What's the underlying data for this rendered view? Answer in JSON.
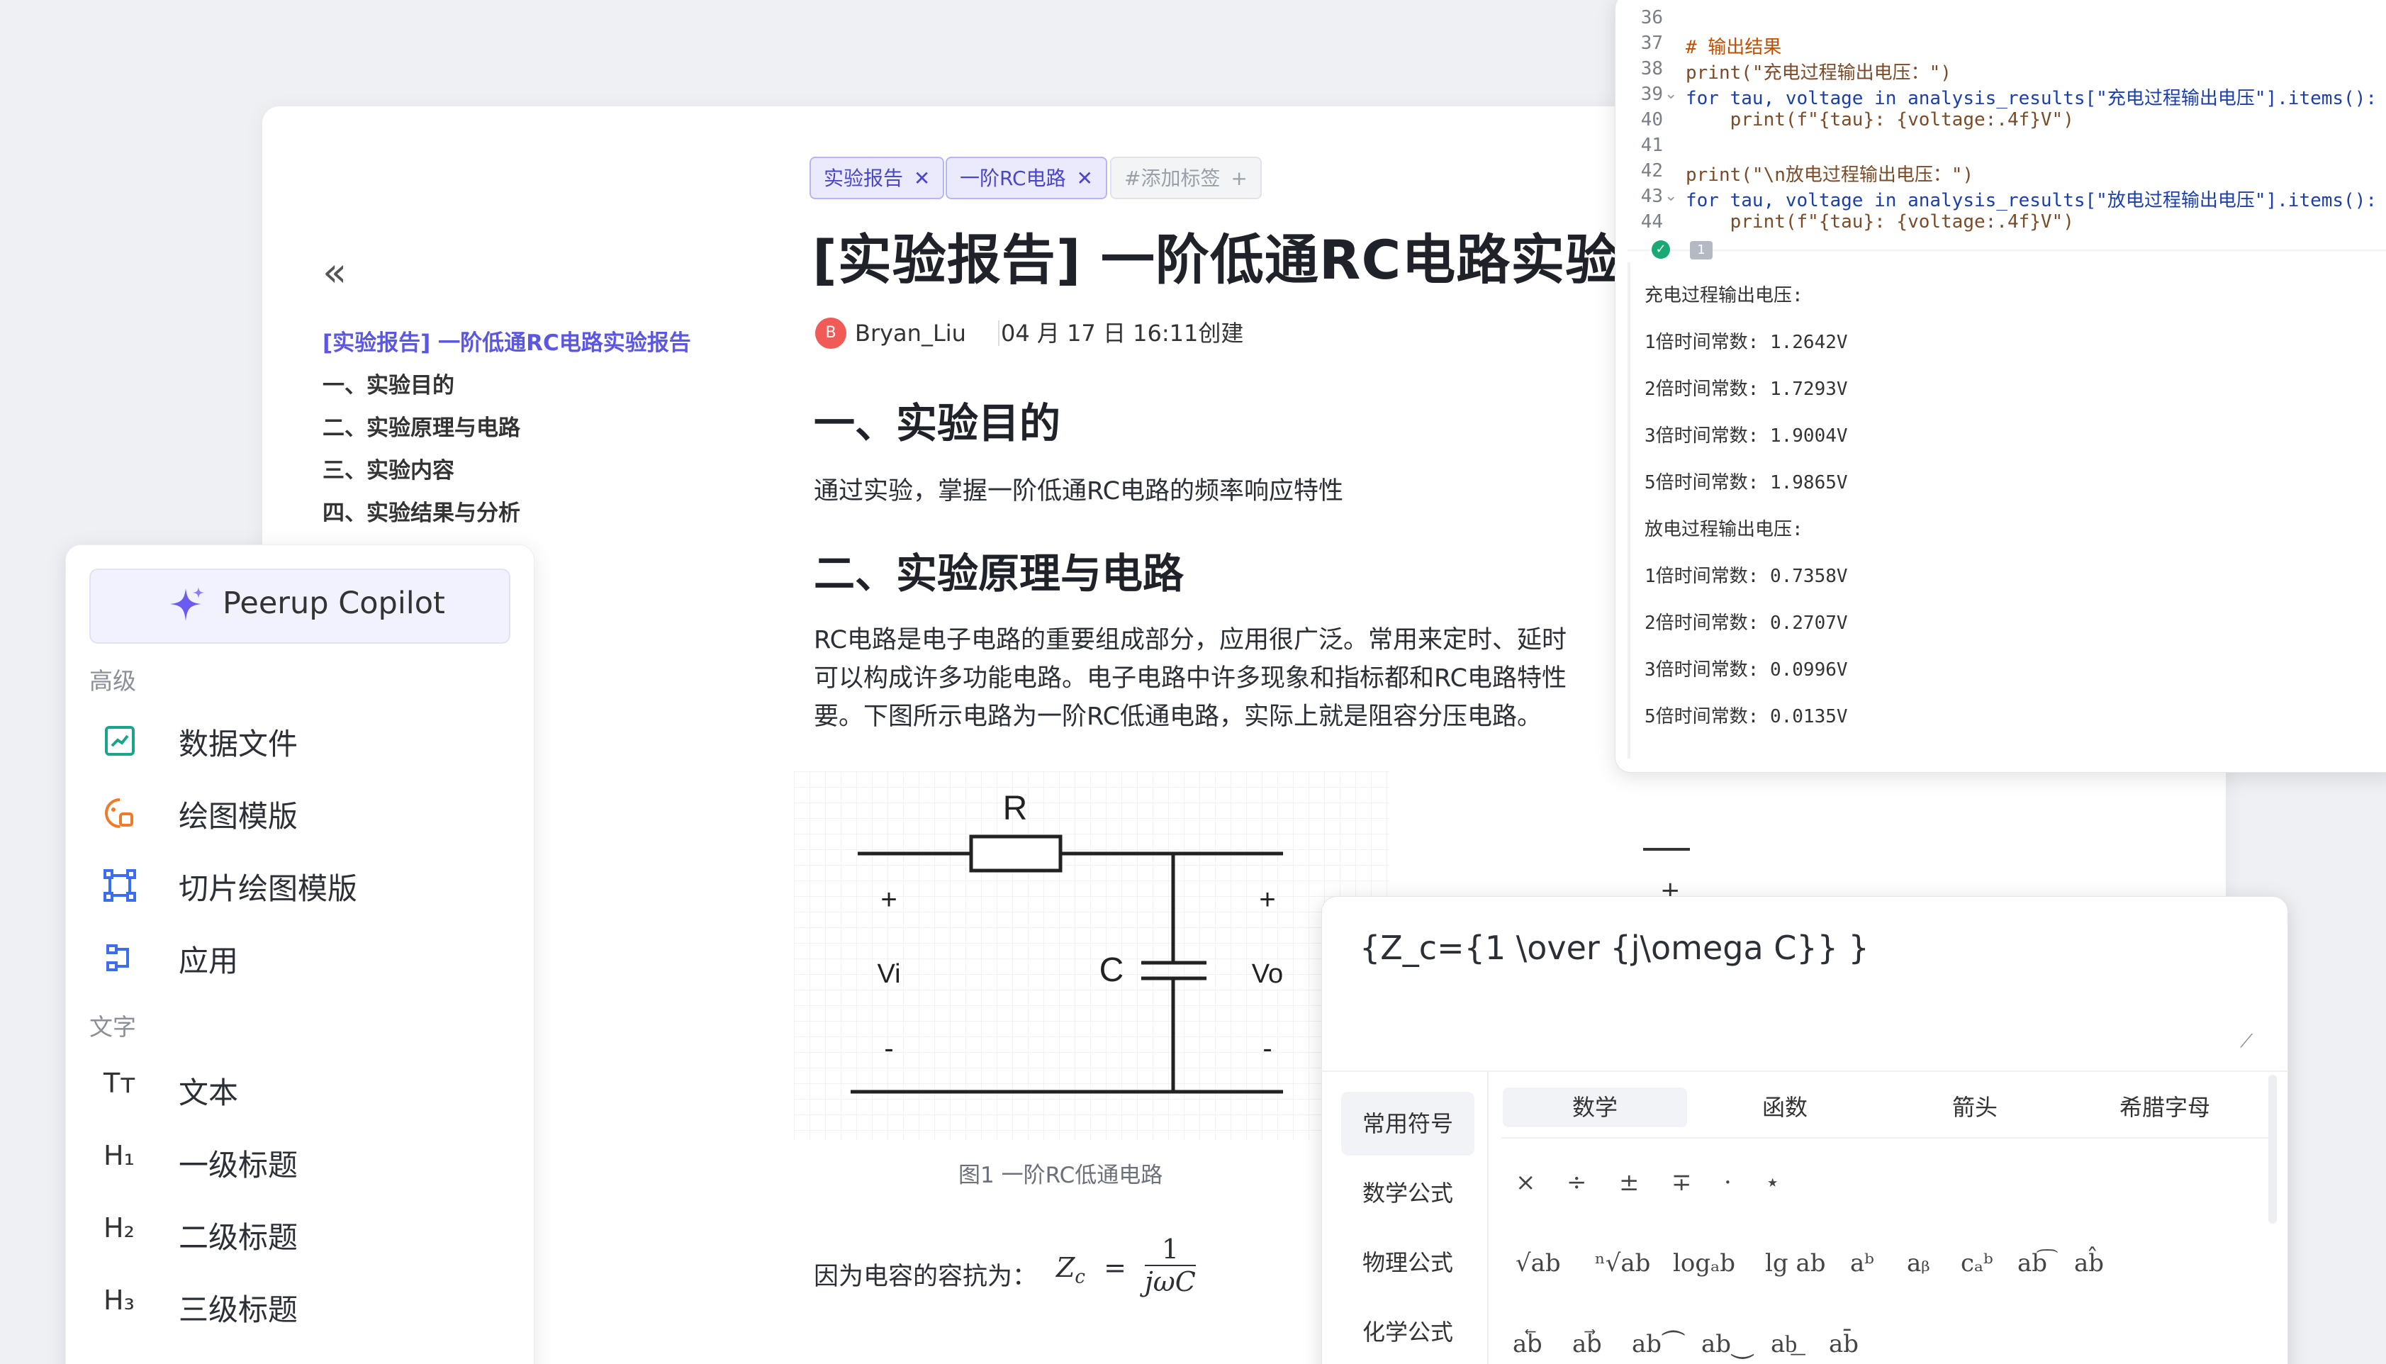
{
  "sidebar_collapse_icon": "double-chevron-left-icon",
  "toc": {
    "title": "[实验报告] 一阶低通RC电路实验报告",
    "items": [
      "一、实验目的",
      "二、实验原理与电路",
      "三、实验内容",
      "四、实验结果与分析"
    ]
  },
  "tags": [
    {
      "label": "实验报告",
      "close": "✕"
    },
    {
      "label": "一阶RC电路",
      "close": "✕"
    }
  ],
  "add_tag_label": "#添加标签",
  "add_tag_icon": "+",
  "doc": {
    "title": "[实验报告] 一阶低通RC电路实验",
    "avatar_letter": "B",
    "author": "Bryan_Liu",
    "created": "04 月 17 日 16:11创建",
    "h_purpose": "一、实验目的",
    "purpose_text": "通过实验，掌握一阶低通RC电路的频率响应特性",
    "h_principle": "二、实验原理与电路",
    "principle_lines": [
      "RC电路是电子电路的重要组成部分，应用很广泛。常用来定时、延时",
      "可以构成许多功能电路。电子电路中许多现象和指标都和RC电路特性",
      "要。下图所示电路为一阶RC低通电路，实际上就是阻容分压电路。"
    ],
    "figure_caption": "图1 一阶RC低通电路",
    "impedance_text": "因为电容的容抗为：",
    "impedance_formula": {
      "lhs": "Z",
      "sub": "c",
      "eq": "=",
      "num": "1",
      "den": "jωC"
    }
  },
  "circuit": {
    "resistor": "R",
    "capacitor": "C",
    "vin": "Vi",
    "vout": "Vo",
    "plus": "+",
    "minus": "-"
  },
  "side_panel": {
    "copilot_label": "Peerup Copilot",
    "section_advanced": "高级",
    "advanced_items": [
      {
        "label": "数据文件",
        "icon": "chart-file-icon"
      },
      {
        "label": "绘图模版",
        "icon": "palette-icon"
      },
      {
        "label": "切片绘图模版",
        "icon": "slice-frame-icon"
      },
      {
        "label": "应用",
        "icon": "app-flow-icon"
      }
    ],
    "section_text": "文字",
    "text_items": [
      {
        "label": "文本",
        "glyph": "Tт"
      },
      {
        "label": "一级标题",
        "glyph": "H₁"
      },
      {
        "label": "二级标题",
        "glyph": "H₂"
      },
      {
        "label": "三级标题",
        "glyph": "H₃"
      }
    ]
  },
  "code": {
    "line_numbers": [
      "36",
      "37",
      "38",
      "39",
      "40",
      "41",
      "42",
      "43",
      "44"
    ],
    "lines": [
      "",
      "# 输出结果",
      "print(\"充电过程输出电压：\")",
      "for tau, voltage in analysis_results[\"充电过程输出电压\"].items():",
      "    print(f\"{tau}: {voltage:.4f}V\")",
      "",
      "print(\"\\n放电过程输出电压：\")",
      "for tau, voltage in analysis_results[\"放电过程输出电压\"].items():",
      "    print(f\"{tau}: {voltage:.4f}V\")"
    ],
    "run_badge": "1",
    "output": [
      "充电过程输出电压:",
      "1倍时间常数: 1.2642V",
      "2倍时间常数: 1.7293V",
      "3倍时间常数: 1.9004V",
      "5倍时间常数: 1.9865V",
      "放电过程输出电压:",
      "1倍时间常数: 0.7358V",
      "2倍时间常数: 0.2707V",
      "3倍时间常数: 0.0996V",
      "5倍时间常数: 0.0135V"
    ]
  },
  "formula_editor": {
    "input": "{Z_c={1 \\over {j\\omega C}} }",
    "categories": [
      "常用符号",
      "数学公式",
      "物理公式",
      "化学公式"
    ],
    "tabs": [
      "数学",
      "函数",
      "箭头",
      "希腊字母"
    ],
    "operators": [
      "×",
      "÷",
      "±",
      "∓",
      "·",
      "⋆"
    ],
    "templates": [
      "√ab",
      "ⁿ√ab",
      "logₐb",
      "lg ab",
      "aᵇ",
      "aᵦ",
      "cₐᵇ",
      "ab͡",
      "ab̂"
    ],
    "arrows": [
      "ab⃖",
      "ab⃗",
      "ab⏜",
      "ab⏝",
      "ab͟",
      "ab̄"
    ]
  },
  "overflow_plus": "+"
}
